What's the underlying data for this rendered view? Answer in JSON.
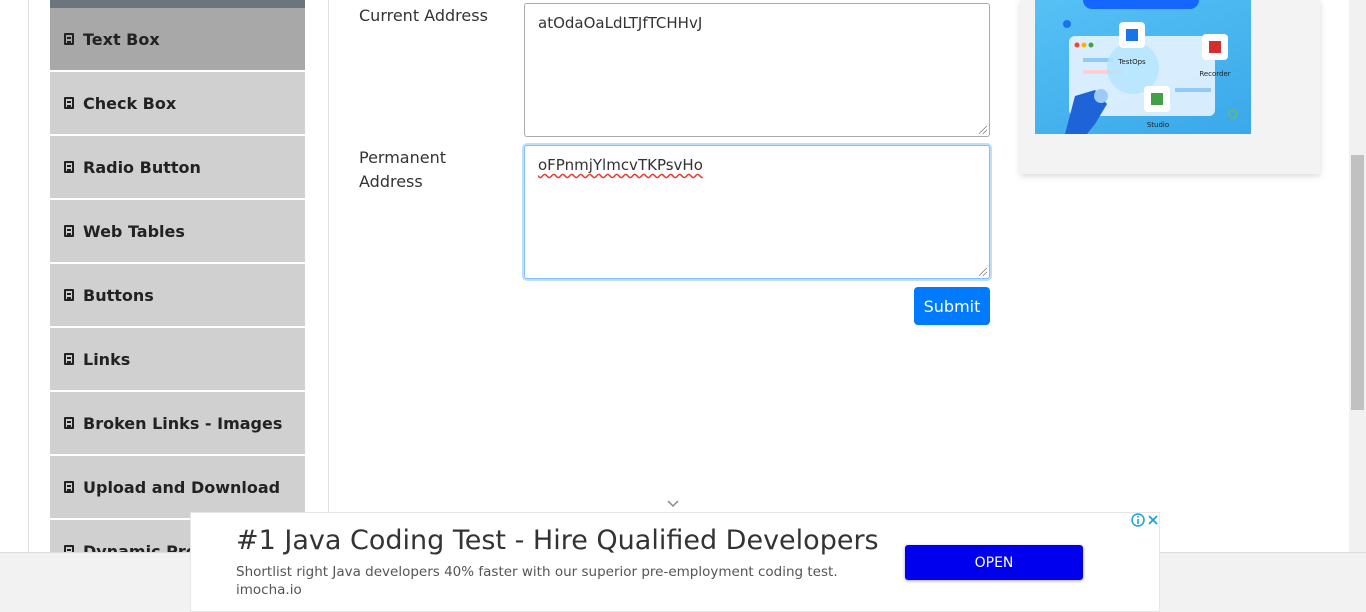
{
  "sidebar": {
    "items": [
      {
        "label": "Text Box",
        "active": true
      },
      {
        "label": "Check Box",
        "active": false
      },
      {
        "label": "Radio Button",
        "active": false
      },
      {
        "label": "Web Tables",
        "active": false
      },
      {
        "label": "Buttons",
        "active": false
      },
      {
        "label": "Links",
        "active": false
      },
      {
        "label": "Broken Links - Images",
        "active": false
      },
      {
        "label": "Upload and Download",
        "active": false
      },
      {
        "label": "Dynamic Properties",
        "active": false
      }
    ]
  },
  "form": {
    "current_address_label": "Current Address",
    "current_address_value": "atOdaOaLdLTJfTCHHvJ",
    "permanent_address_label_line1": "Permanent",
    "permanent_address_label_line2": "Address",
    "permanent_address_value": "oFPnmjYlmcvTKPsvHo",
    "submit_label": "Submit"
  },
  "ad_card": {
    "labels": [
      "TestOps",
      "Recorder",
      "Studio"
    ]
  },
  "bottom_ad": {
    "headline": "#1 Java Coding Test - Hire Qualified Developers",
    "description": "Shortlist right Java developers 40% faster with our superior pre-employment coding test.",
    "domain": "imocha.io",
    "cta": "OPEN"
  },
  "colors": {
    "primary": "#007bff",
    "ad_cta": "#0000ee",
    "sidebar_active": "#a8a8a8",
    "sidebar_item": "#d0d0d0"
  }
}
